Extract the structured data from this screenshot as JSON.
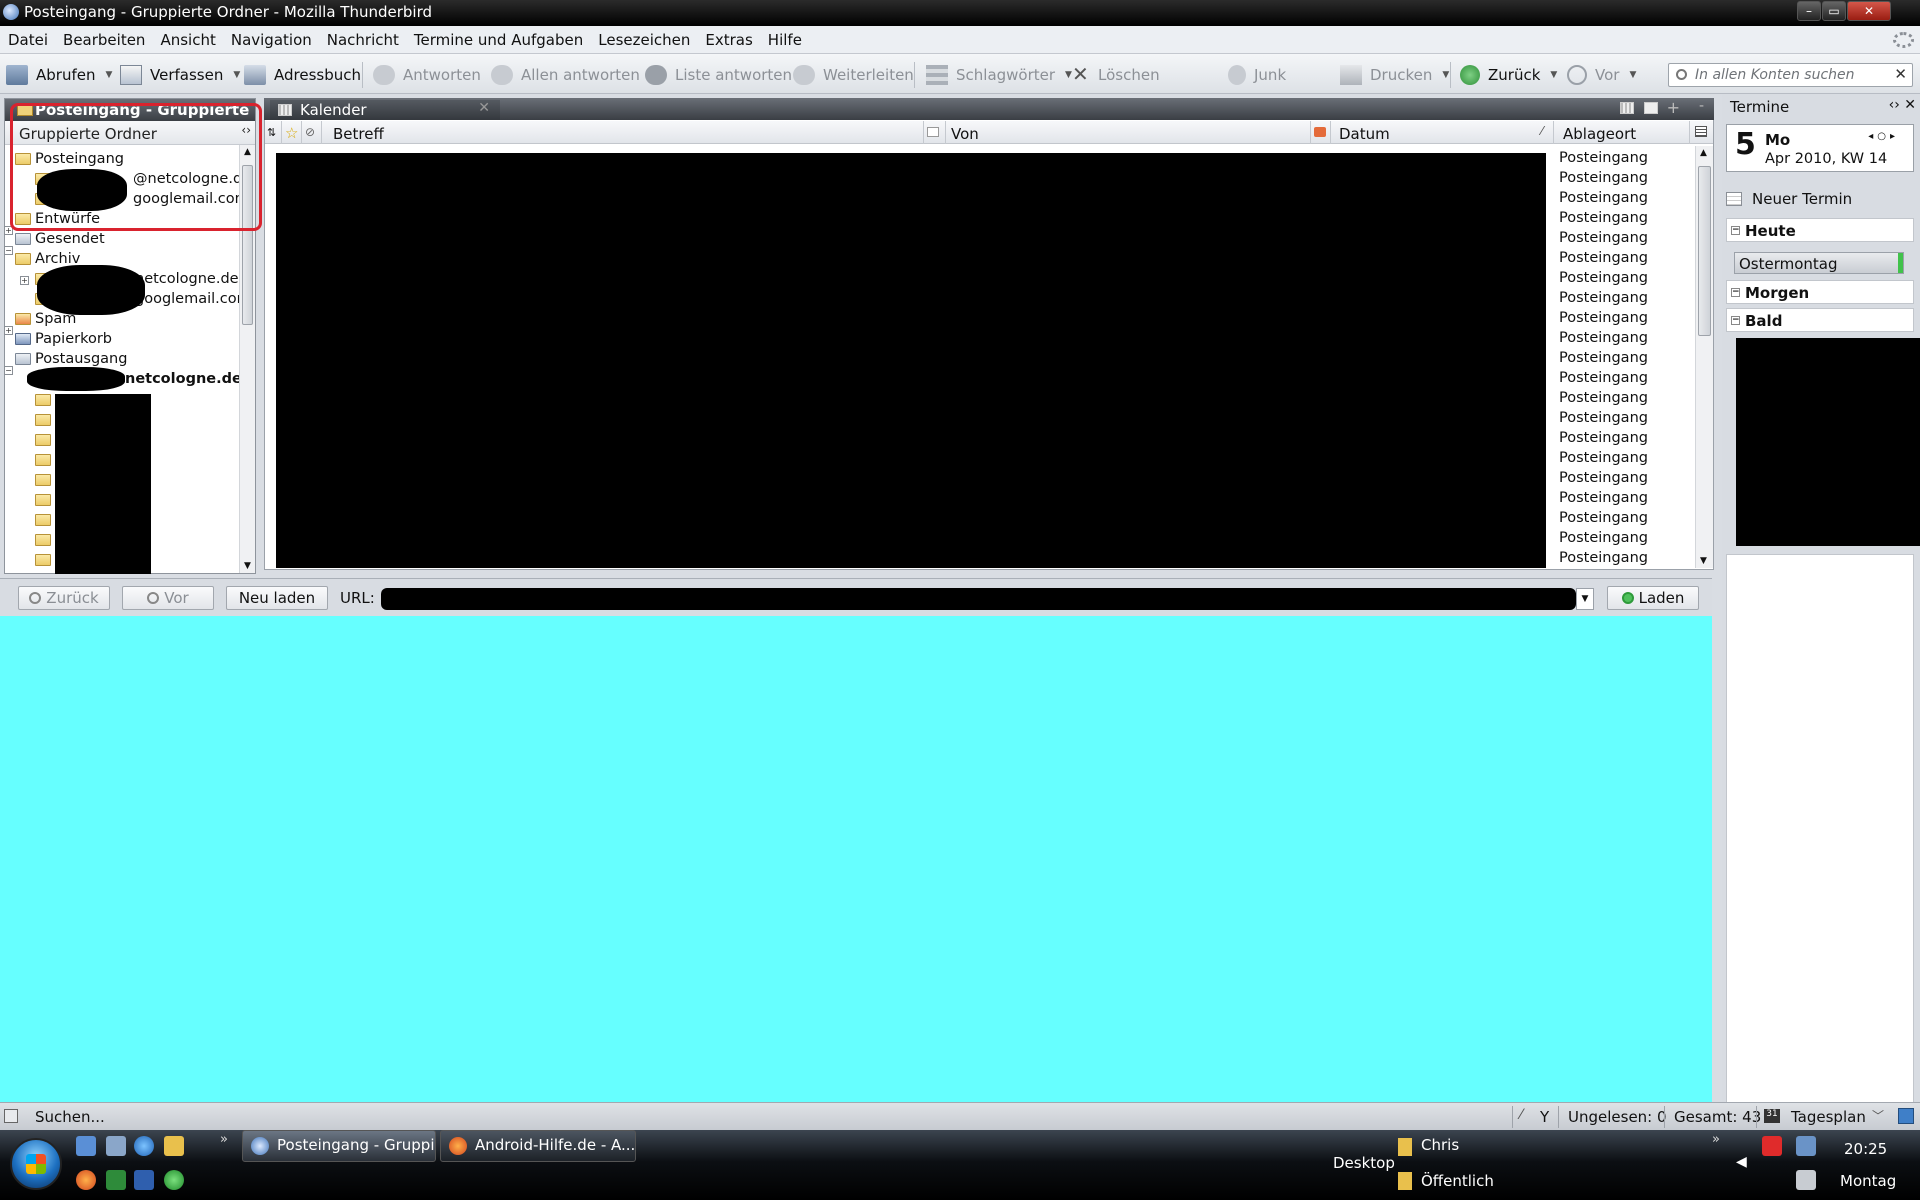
{
  "window": {
    "title": "Posteingang - Gruppierte Ordner - Mozilla Thunderbird",
    "controls": [
      "–",
      "▭",
      "✕"
    ]
  },
  "menu": [
    "Datei",
    "Bearbeiten",
    "Ansicht",
    "Navigation",
    "Nachricht",
    "Termine und Aufgaben",
    "Lesezeichen",
    "Extras",
    "Hilfe"
  ],
  "toolbar": {
    "abrufen": "Abrufen",
    "verfassen": "Verfassen",
    "adressbuch": "Adressbuch",
    "antworten": "Antworten",
    "allen_antworten": "Allen antworten",
    "liste_antworten": "Liste antworten",
    "weiterleiten": "Weiterleiten",
    "schlagwoerter": "Schlagwörter",
    "loeschen": "Löschen",
    "junk": "Junk",
    "drucken": "Drucken",
    "zurueck": "Zurück",
    "vor": "Vor",
    "search_placeholder": "In allen Konten suchen"
  },
  "folderpane": {
    "title": "Posteingang - Gruppierte O...",
    "column": "Gruppierte Ordner",
    "folders": {
      "posteingang": "Posteingang",
      "acct1": "@netcologne.de",
      "acct2": "googlemail.com",
      "entwuerfe": "Entwürfe",
      "gesendet": "Gesendet",
      "archiv": "Archiv",
      "archiv_acct1": "netcologne.de",
      "archiv_acct2": "googlemail.com",
      "spam": "Spam",
      "papierkorb": "Papierkorb",
      "postausgang": "Postausgang",
      "account": "netcologne.de"
    }
  },
  "tabs": {
    "kalender": "Kalender"
  },
  "messagelist": {
    "columns": {
      "betreff": "Betreff",
      "von": "Von",
      "datum": "Datum",
      "ablageort": "Ablageort"
    },
    "locations": [
      "Posteingang",
      "Posteingang",
      "Posteingang",
      "Posteingang",
      "Posteingang",
      "Posteingang",
      "Posteingang",
      "Posteingang",
      "Posteingang",
      "Posteingang",
      "Posteingang",
      "Posteingang",
      "Posteingang",
      "Posteingang",
      "Posteingang",
      "Posteingang",
      "Posteingang",
      "Posteingang",
      "Posteingang",
      "Posteingang",
      "Posteingang"
    ]
  },
  "browser": {
    "zurueck": "Zurück",
    "vor": "Vor",
    "neu_laden": "Neu laden",
    "url_label": "URL:",
    "laden": "Laden",
    "content_color": "#66ffff"
  },
  "termine": {
    "title": "Termine",
    "day": "5",
    "weekday": "Mo",
    "month_week": "Apr 2010, KW 14",
    "neuer_termin": "Neuer Termin",
    "heute": "Heute",
    "event": "Ostermontag",
    "morgen": "Morgen",
    "bald": "Bald"
  },
  "status": {
    "text": "Suchen...",
    "y": "Y",
    "ungelesen": "Ungelesen: 0",
    "gesamt": "Gesamt: 43",
    "tagesplan": "Tagesplan"
  },
  "taskbar": {
    "task1": "Posteingang - Gruppi...",
    "task2": "Android-Hilfe.de - A...",
    "desktop": "Desktop",
    "chris": "Chris",
    "oeffentlich": "Öffentlich",
    "time": "20:25",
    "day": "Montag"
  }
}
